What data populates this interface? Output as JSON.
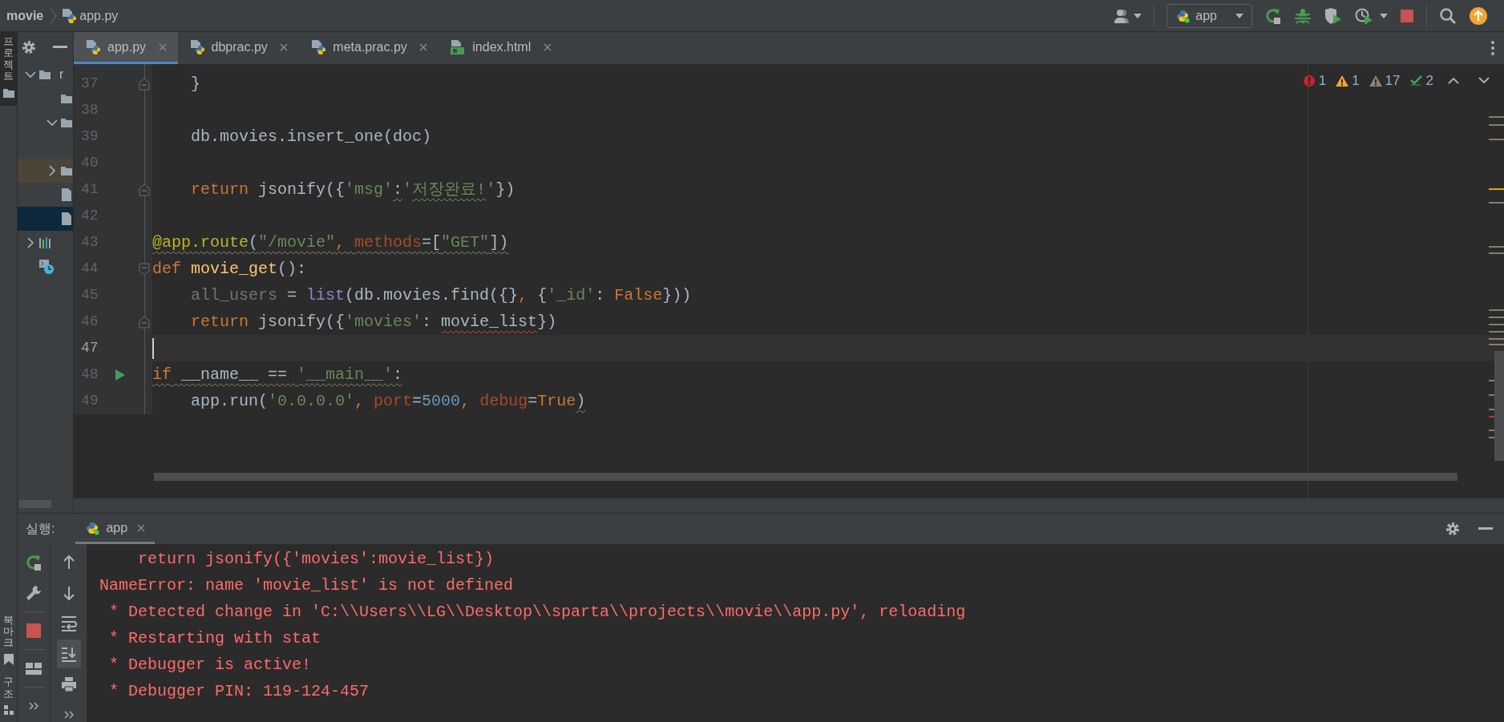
{
  "breadcrumb": [
    {
      "label": "movie",
      "kind": "project"
    },
    {
      "label": "app.py",
      "kind": "python"
    }
  ],
  "run_config": {
    "label": "app",
    "running": true
  },
  "tool_stripe": [
    {
      "label": "프로젝트",
      "kind": "project",
      "selected": true
    },
    {
      "label": "북마크",
      "kind": "bookmarks",
      "selected": false
    },
    {
      "label": "구조",
      "kind": "structure",
      "selected": false
    }
  ],
  "project_tree": [
    {
      "kind": "folder",
      "label": "r",
      "expanded": true,
      "selected": false,
      "highlighted": false,
      "children": [
        {
          "kind": "plain-folder",
          "selected": false,
          "highlighted": false
        },
        {
          "kind": "folder",
          "expanded": true,
          "selected": false,
          "highlighted": false
        },
        {
          "kind": "folder",
          "expanded": false,
          "selected": false,
          "highlighted": true
        },
        {
          "kind": "file",
          "selected": false,
          "highlighted": false
        },
        {
          "kind": "file",
          "selected": true,
          "highlighted": false
        }
      ]
    },
    {
      "kind": "libraries",
      "expanded": false,
      "selected": false,
      "highlighted": false
    },
    {
      "kind": "scratches",
      "selected": false,
      "highlighted": false
    }
  ],
  "editor_tabs": [
    {
      "label": "app.py",
      "kind": "python",
      "selected": true
    },
    {
      "label": "dbprac.py",
      "kind": "python",
      "selected": false
    },
    {
      "label": "meta.prac.py",
      "kind": "python",
      "selected": false
    },
    {
      "label": "index.html",
      "kind": "html",
      "selected": false
    }
  ],
  "inspections": [
    {
      "kind": "error",
      "count": "1"
    },
    {
      "kind": "warning",
      "count": "1"
    },
    {
      "kind": "weak",
      "count": "17"
    },
    {
      "kind": "typo",
      "count": "2"
    }
  ],
  "code_lines": [
    {
      "number": "37",
      "kind": "fold-end",
      "current": false,
      "tokens": [
        {
          "text": "    }",
          "kind": "plain"
        }
      ]
    },
    {
      "number": "38",
      "kind": "plain",
      "current": false
    },
    {
      "number": "39",
      "kind": "plain",
      "current": false,
      "tokens": [
        {
          "text": "    db.movies.insert_one(doc)",
          "kind": "plain"
        }
      ]
    },
    {
      "number": "40",
      "kind": "plain",
      "current": false
    },
    {
      "number": "41",
      "kind": "fold-end",
      "current": false,
      "tokens": [
        {
          "text": "    return",
          "kind": "keyword"
        },
        {
          "text": " jsonify({",
          "kind": "plain"
        },
        {
          "text": "'msg'",
          "kind": "string"
        },
        {
          "text": ":",
          "kind": "plain-weak"
        },
        {
          "text": "'",
          "kind": "string"
        },
        {
          "text": "저장완료!",
          "kind": "string-typo"
        },
        {
          "text": "'",
          "kind": "string"
        },
        {
          "text": "})",
          "kind": "plain"
        }
      ]
    },
    {
      "number": "42",
      "kind": "plain",
      "current": false
    },
    {
      "number": "43",
      "kind": "plain",
      "current": false,
      "tokens": [
        {
          "text": "@app.route",
          "kind": "decorator-weak"
        },
        {
          "text": "(",
          "kind": "plain-weak"
        },
        {
          "text": "\"/movie\"",
          "kind": "string-weak"
        },
        {
          "text": ", ",
          "kind": "keyword-weak"
        },
        {
          "text": "methods",
          "kind": "param-weak"
        },
        {
          "text": "=[",
          "kind": "plain-weak"
        },
        {
          "text": "\"GET\"",
          "kind": "string-weak"
        },
        {
          "text": "])",
          "kind": "plain-weak"
        }
      ]
    },
    {
      "number": "44",
      "kind": "fold-start",
      "current": false,
      "tokens": [
        {
          "text": "def ",
          "kind": "keyword"
        },
        {
          "text": "movie_get",
          "kind": "function"
        },
        {
          "text": "():",
          "kind": "plain"
        }
      ]
    },
    {
      "number": "45",
      "kind": "plain",
      "current": false,
      "tokens": [
        {
          "text": "    all_users",
          "kind": "unused"
        },
        {
          "text": " = ",
          "kind": "plain"
        },
        {
          "text": "list",
          "kind": "builtin"
        },
        {
          "text": "(db.movies.find({}",
          "kind": "plain"
        },
        {
          "text": ", ",
          "kind": "keyword"
        },
        {
          "text": "{",
          "kind": "plain"
        },
        {
          "text": "'_id'",
          "kind": "string"
        },
        {
          "text": ": ",
          "kind": "plain"
        },
        {
          "text": "False",
          "kind": "keyword"
        },
        {
          "text": "}))",
          "kind": "plain"
        }
      ]
    },
    {
      "number": "46",
      "kind": "fold-end",
      "current": false,
      "tokens": [
        {
          "text": "    return",
          "kind": "keyword"
        },
        {
          "text": " jsonify({",
          "kind": "plain"
        },
        {
          "text": "'movies'",
          "kind": "string"
        },
        {
          "text": ": ",
          "kind": "plain"
        },
        {
          "text": "movie_list",
          "kind": "plain-error"
        },
        {
          "text": "})",
          "kind": "plain"
        }
      ]
    },
    {
      "number": "47",
      "kind": "plain",
      "current": true
    },
    {
      "number": "48",
      "kind": "run",
      "current": false,
      "tokens": [
        {
          "text": "if",
          "kind": "keyword-weak"
        },
        {
          "text": " __name__ == ",
          "kind": "plain-weak"
        },
        {
          "text": "'__main__'",
          "kind": "string-weak"
        },
        {
          "text": ":",
          "kind": "plain-weak"
        }
      ]
    },
    {
      "number": "49",
      "kind": "plain",
      "current": false,
      "tokens": [
        {
          "text": "    app.run(",
          "kind": "plain"
        },
        {
          "text": "'0.0.0.0'",
          "kind": "string"
        },
        {
          "text": ", ",
          "kind": "keyword"
        },
        {
          "text": "port",
          "kind": "param"
        },
        {
          "text": "=",
          "kind": "plain"
        },
        {
          "text": "5000",
          "kind": "number"
        },
        {
          "text": ", ",
          "kind": "keyword"
        },
        {
          "text": "debug",
          "kind": "param"
        },
        {
          "text": "=",
          "kind": "plain"
        },
        {
          "text": "True",
          "kind": "keyword"
        },
        {
          "text": ")",
          "kind": "plain-weak"
        }
      ]
    }
  ],
  "run_panel": {
    "title": "실행:",
    "tabs": [
      {
        "label": "app",
        "selected": true,
        "running": true
      }
    ],
    "soft_wrap": {
      "on": false
    },
    "scroll_to_end": {
      "on": true
    },
    "console": [
      {
        "text": "    return jsonify({'movies':movie_list})",
        "kind": "stderr"
      },
      {
        "text": "NameError: name 'movie_list' is not defined",
        "kind": "stderr"
      },
      {
        "text": " * Detected change in 'C:\\\\Users\\\\LG\\\\Desktop\\\\sparta\\\\projects\\\\movie\\\\app.py', reloading",
        "kind": "stderr"
      },
      {
        "text": " * Restarting with stat",
        "kind": "stderr"
      },
      {
        "text": " * Debugger is active!",
        "kind": "stderr"
      },
      {
        "text": " * Debugger PIN: 119-124-457",
        "kind": "stderr"
      }
    ]
  }
}
